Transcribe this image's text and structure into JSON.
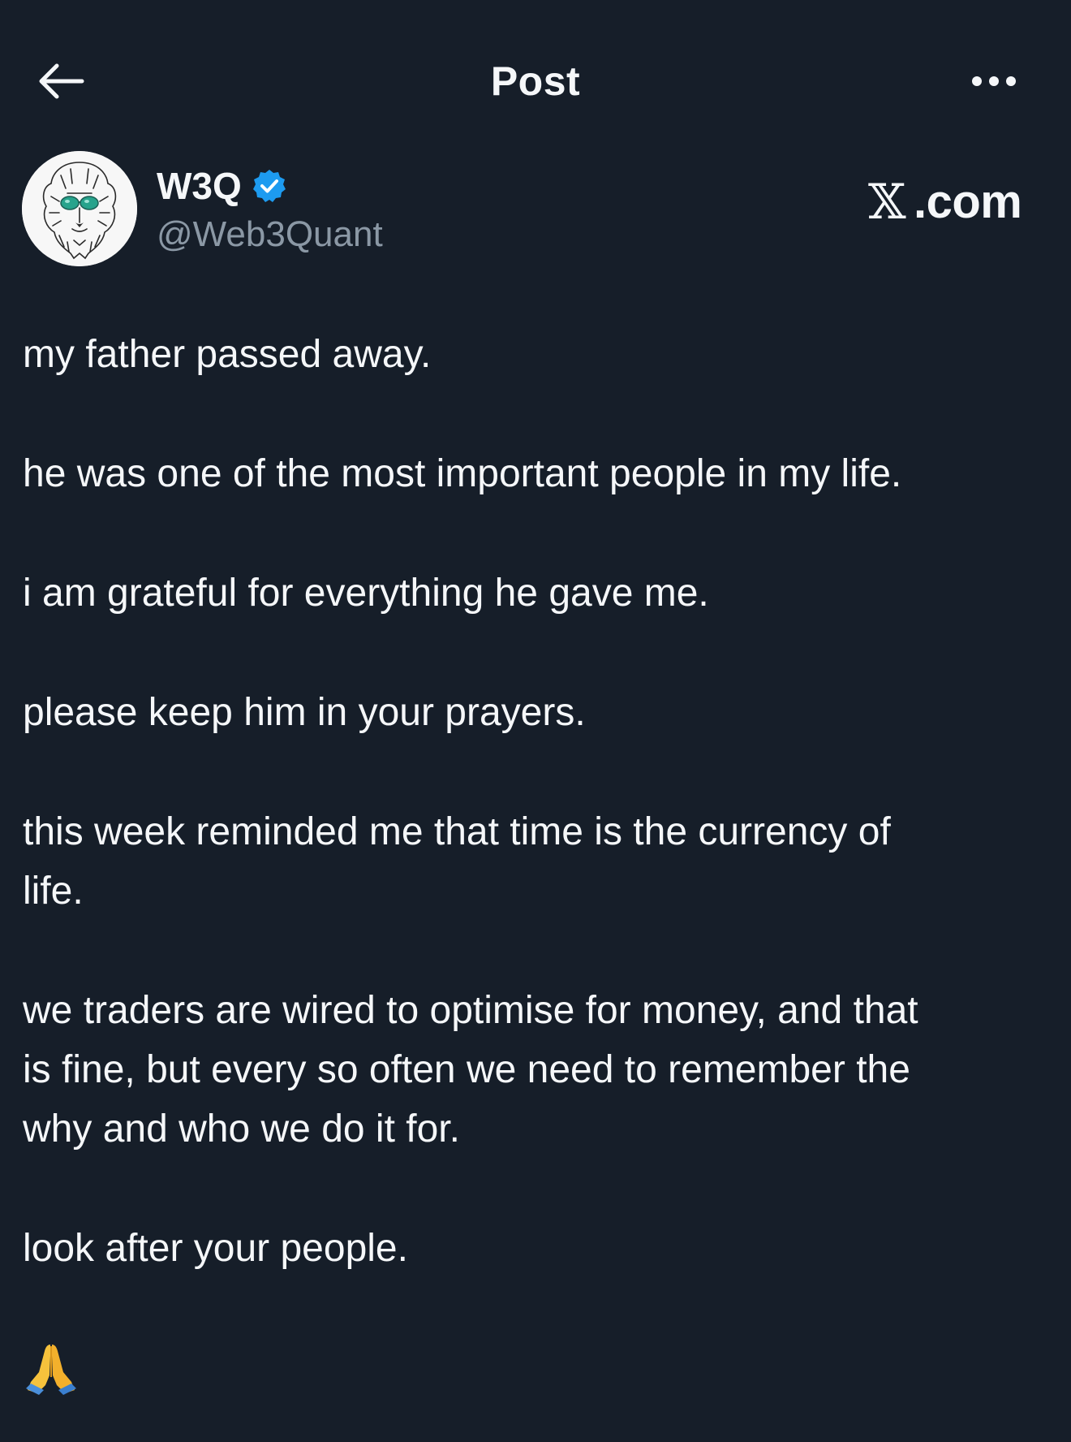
{
  "topbar": {
    "back_icon": "arrow-left-icon",
    "title": "Post",
    "more_icon": "more-horizontal-icon"
  },
  "author": {
    "display_name": "W3Q",
    "handle": "@Web3Quant",
    "verified_icon": "verified-badge-icon",
    "avatar_icon": "lion-avatar",
    "verified_color": "#1d9bf0"
  },
  "watermark": {
    "brand_symbol": "𝕏",
    "brand_text": ".com"
  },
  "post": {
    "paragraphs": [
      "my father passed away.",
      "he was one of the most important people in my life.",
      "i am grateful for everything he gave me.",
      "please keep him in your prayers.",
      "this week reminded me that time is the currency of\nlife.",
      "we traders are wired to optimise for money, and that\nis fine, but every so often we need to remember the\nwhy and who we do it for.",
      "look after your people."
    ],
    "emoji_icon": "folded-hands-emoji"
  },
  "colors": {
    "background": "#161e29",
    "text": "#f5f7f9",
    "secondary_text": "#8b98a5"
  }
}
